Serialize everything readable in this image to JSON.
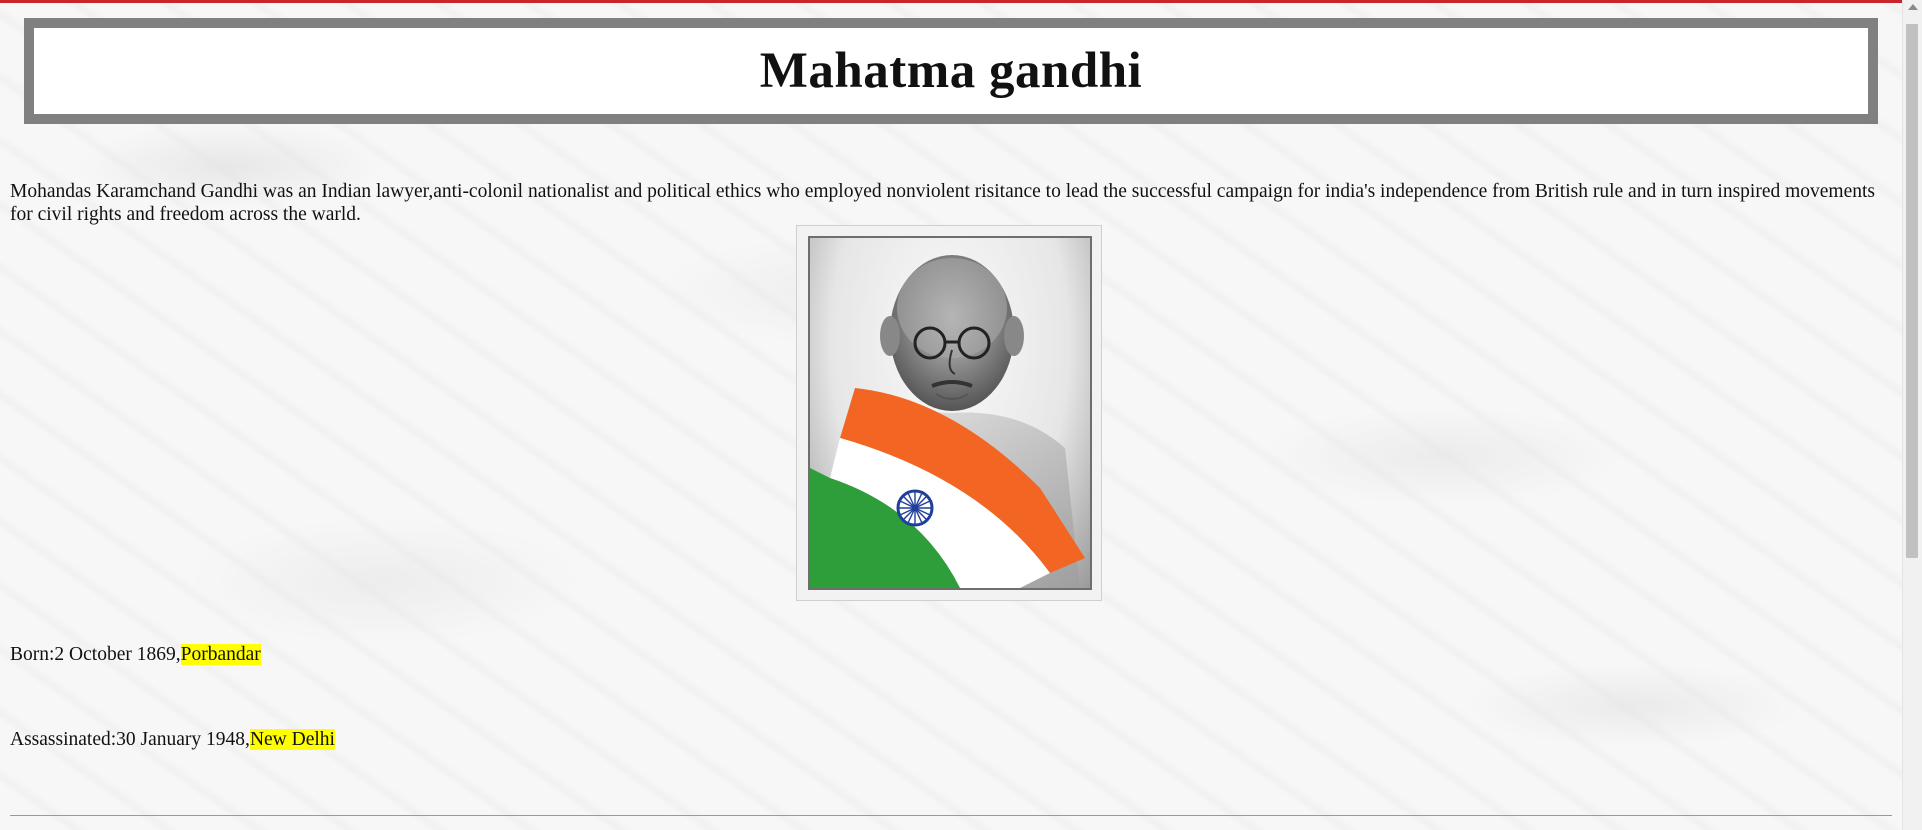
{
  "page": {
    "title": "Mahatma gandhi",
    "intro": "Mohandas Karamchand Gandhi was an Indian lawyer,anti-colonil nationalist and political ethics who employed nonviolent risitance to lead the successful campaign for india's independence from British rule and in turn inspired movements for civil rights and freedom across the warld."
  },
  "portrait": {
    "alt": "Portrait of Mahatma Gandhi with Indian tricolour scarf"
  },
  "facts": {
    "born_label": "Born:2 October 1869,",
    "born_place": "Porbandar",
    "death_label": "Assassinated:30 January 1948,",
    "death_place": "New Delhi"
  },
  "colors": {
    "accent": "#c9252b",
    "title_border": "#808080",
    "highlight": "#ffff00",
    "saffron": "#f26522",
    "green": "#2e9e3a",
    "chakra_blue": "#1f3f9a"
  },
  "scrollbar": {
    "position_fraction": 0.0
  }
}
